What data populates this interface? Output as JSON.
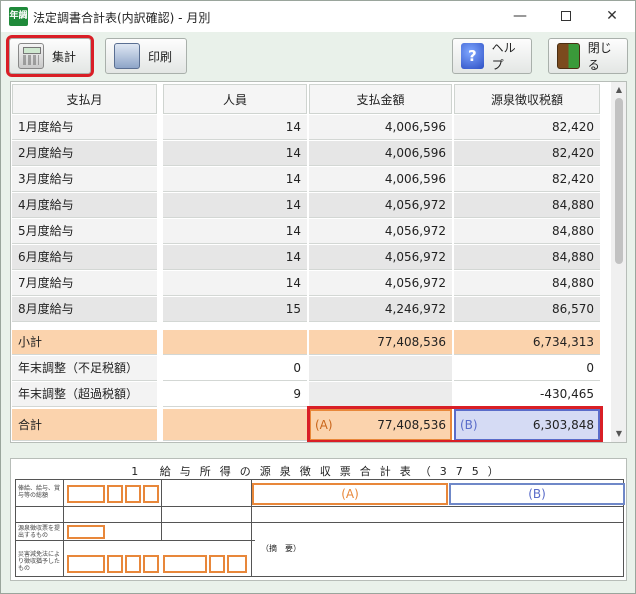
{
  "window": {
    "app_icon_text": "年調",
    "title": "法定調書合計表(内訳確認) - 月別",
    "minimize_glyph": "—",
    "close_glyph": "✕"
  },
  "toolbar": {
    "total_label": "集計",
    "print_label": "印刷",
    "help_label": "ヘルプ",
    "close_label": "閉じる",
    "help_glyph": "?"
  },
  "grid": {
    "headers": [
      "支払月",
      "人員",
      "支払金額",
      "源泉徴収税額"
    ],
    "rows": [
      {
        "month": "1月度給与",
        "people": "14",
        "paid": "4,006,596",
        "tax": "82,420"
      },
      {
        "month": "2月度給与",
        "people": "14",
        "paid": "4,006,596",
        "tax": "82,420"
      },
      {
        "month": "3月度給与",
        "people": "14",
        "paid": "4,006,596",
        "tax": "82,420"
      },
      {
        "month": "4月度給与",
        "people": "14",
        "paid": "4,056,972",
        "tax": "84,880"
      },
      {
        "month": "5月度給与",
        "people": "14",
        "paid": "4,056,972",
        "tax": "84,880"
      },
      {
        "month": "6月度給与",
        "people": "14",
        "paid": "4,056,972",
        "tax": "84,880"
      },
      {
        "month": "7月度給与",
        "people": "14",
        "paid": "4,056,972",
        "tax": "84,880"
      },
      {
        "month": "8月度給与",
        "people": "15",
        "paid": "4,246,972",
        "tax": "86,570"
      }
    ],
    "subtotal": {
      "label": "小計",
      "people": "",
      "paid": "77,408,536",
      "tax": "6,734,313"
    },
    "adjust_short": {
      "label": "年末調整（不足税額）",
      "people": "0",
      "paid": "",
      "tax": "0"
    },
    "adjust_over": {
      "label": "年末調整（超過税額）",
      "people": "9",
      "paid": "",
      "tax": "-430,465"
    },
    "total": {
      "label": "合計",
      "people": "",
      "mark_a": "(A)",
      "paid": "77,408,536",
      "mark_b": "(B)",
      "tax": "6,303,848"
    }
  },
  "form": {
    "title": "1 給与所得の源泉徴収票合計表（375）",
    "box_a": "(A)",
    "box_b": "(B)",
    "tekiyo": "（摘　要）",
    "labels": [
      "俸給、給与、賞与等の総額",
      "源泉徴収票を提出するもの",
      "災害減免法により徴収猶予したもの"
    ]
  },
  "colors": {
    "highlight_red": "#d91f26",
    "summary_orange": "#fbd3ad",
    "box_a_orange": "#e8873a",
    "box_b_blue": "#5a6cc9"
  }
}
